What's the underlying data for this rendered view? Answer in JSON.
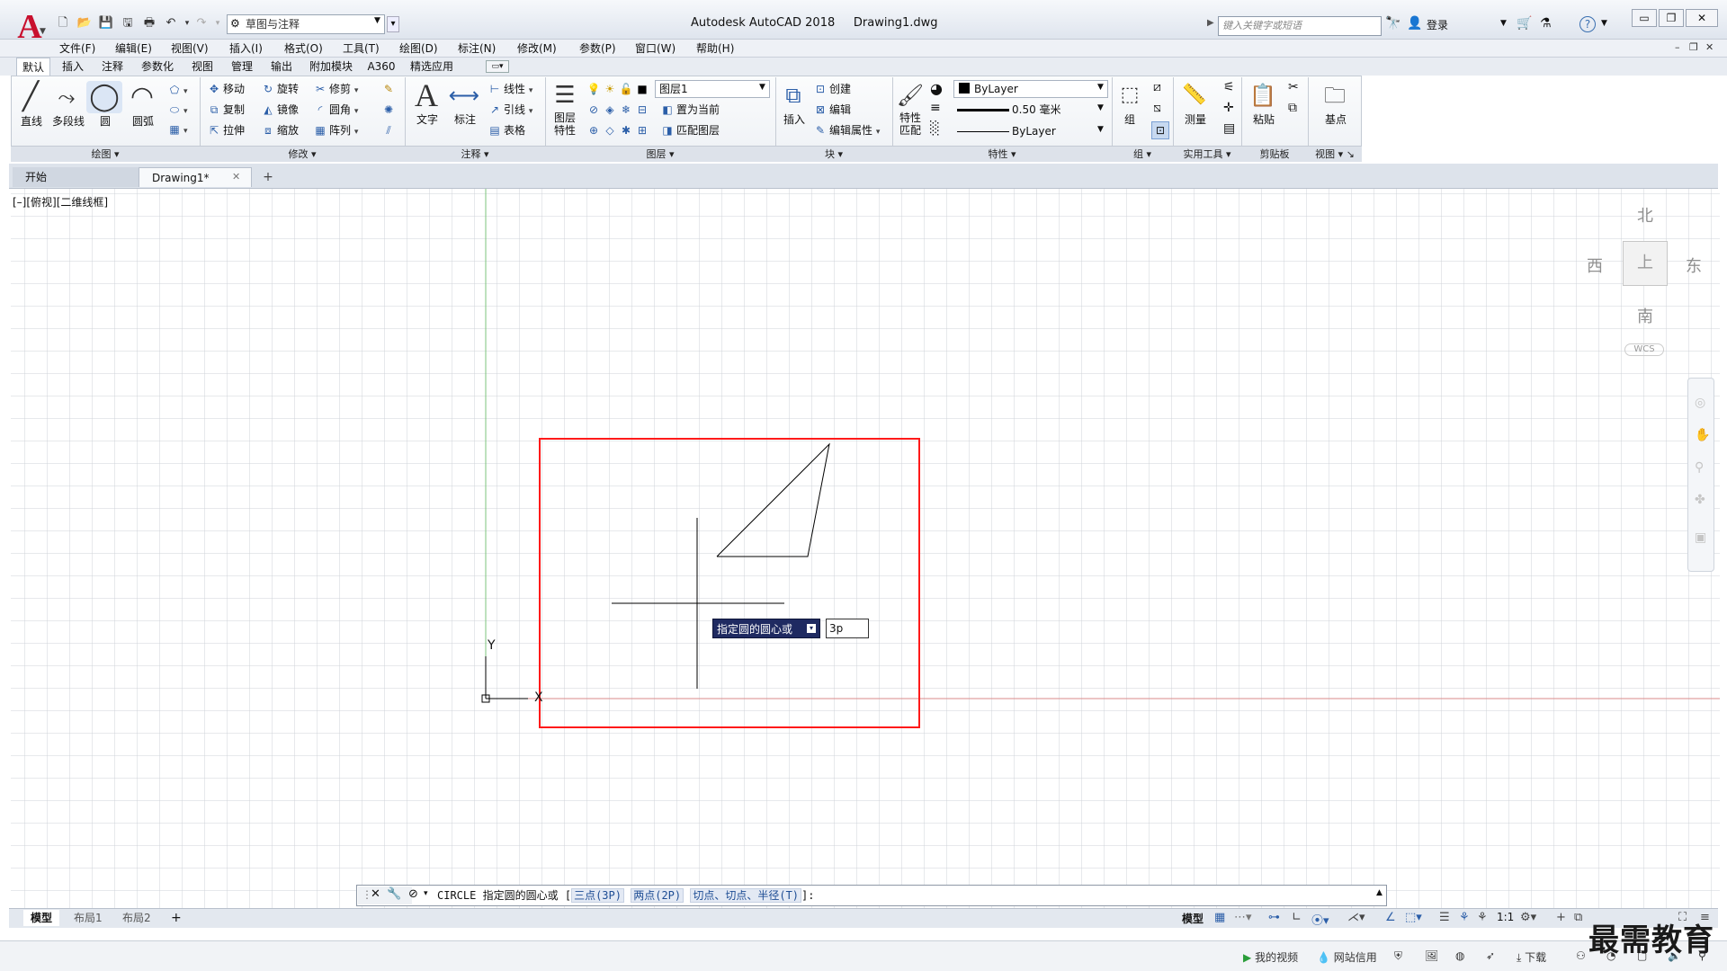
{
  "app": {
    "title": "Autodesk AutoCAD 2018",
    "file": "Drawing1.dwg",
    "logo_letter": "A"
  },
  "workspace": {
    "value": "草图与注释"
  },
  "search": {
    "placeholder": "键入关键字或短语"
  },
  "user": {
    "login_label": "登录"
  },
  "menu": {
    "items": [
      "文件(F)",
      "编辑(E)",
      "视图(V)",
      "插入(I)",
      "格式(O)",
      "工具(T)",
      "绘图(D)",
      "标注(N)",
      "修改(M)",
      "参数(P)",
      "窗口(W)",
      "帮助(H)"
    ]
  },
  "ribbon_tabs": [
    "默认",
    "插入",
    "注释",
    "参数化",
    "视图",
    "管理",
    "输出",
    "附加模块",
    "A360",
    "精选应用"
  ],
  "ribbon": {
    "draw": {
      "title": "绘图",
      "line": "直线",
      "polyline": "多段线",
      "circle": "圆",
      "arc": "圆弧"
    },
    "modify": {
      "title": "修改",
      "move": "移动",
      "rotate": "旋转",
      "trim": "修剪",
      "copy": "复制",
      "mirror": "镜像",
      "fillet": "圆角",
      "stretch": "拉伸",
      "scale": "缩放",
      "array": "阵列"
    },
    "annotation": {
      "title": "注释",
      "text": "文字",
      "dimension": "标注",
      "linear": "线性",
      "leader": "引线",
      "table": "表格"
    },
    "layers": {
      "title": "图层",
      "layer_props_1": "图层",
      "layer_props_2": "特性",
      "current_layer": "图层1",
      "set_current": "置为当前",
      "match_layer": "匹配图层"
    },
    "block": {
      "title": "块",
      "insert": "插入",
      "create": "创建",
      "edit": "编辑",
      "edit_attr": "编辑属性"
    },
    "properties": {
      "title": "特性",
      "match_1": "特性",
      "match_2": "匹配",
      "color": "ByLayer",
      "lineweight": "0.50 毫米",
      "linetype": "ByLayer"
    },
    "groups": {
      "title": "组",
      "group": "组"
    },
    "utilities": {
      "title": "实用工具",
      "measure": "测量"
    },
    "clipboard": {
      "title": "剪贴板",
      "paste": "粘贴"
    },
    "view": {
      "title": "视图",
      "base": "基点"
    }
  },
  "doc_tabs": {
    "start": "开始",
    "drawing": "Drawing1*"
  },
  "viewport": {
    "label": "[–][俯视][二维线框]"
  },
  "viewcube": {
    "north": "北",
    "south": "南",
    "east": "东",
    "west": "西",
    "top": "上",
    "wcs": "WCS"
  },
  "ucs": {
    "x": "X",
    "y": "Y"
  },
  "dynamic_input": {
    "prompt": "指定圆的圆心或",
    "value": "3p"
  },
  "command": {
    "name": "CIRCLE",
    "prompt": "指定圆的圆心或",
    "opt1": "三点(3P)",
    "opt2": "两点(2P)",
    "opt3": "切点、切点、半径(T)",
    "open": "[",
    "close": "]:"
  },
  "layout_tabs": [
    "模型",
    "布局1",
    "布局2"
  ],
  "status": {
    "model": "模型",
    "scale": "1:1"
  },
  "bottom_bar": {
    "my_video": "我的视频",
    "net_credit": "网站信用",
    "download": "下载"
  },
  "watermark": "最需教育",
  "colors": {
    "highlight_box": "#ff1a1a",
    "x_axis": "#d88a8a",
    "y_axis": "#7cc47c",
    "grid": "#cfd3d9",
    "prompt_bg": "#1f2a61",
    "logo": "#c8102e"
  }
}
